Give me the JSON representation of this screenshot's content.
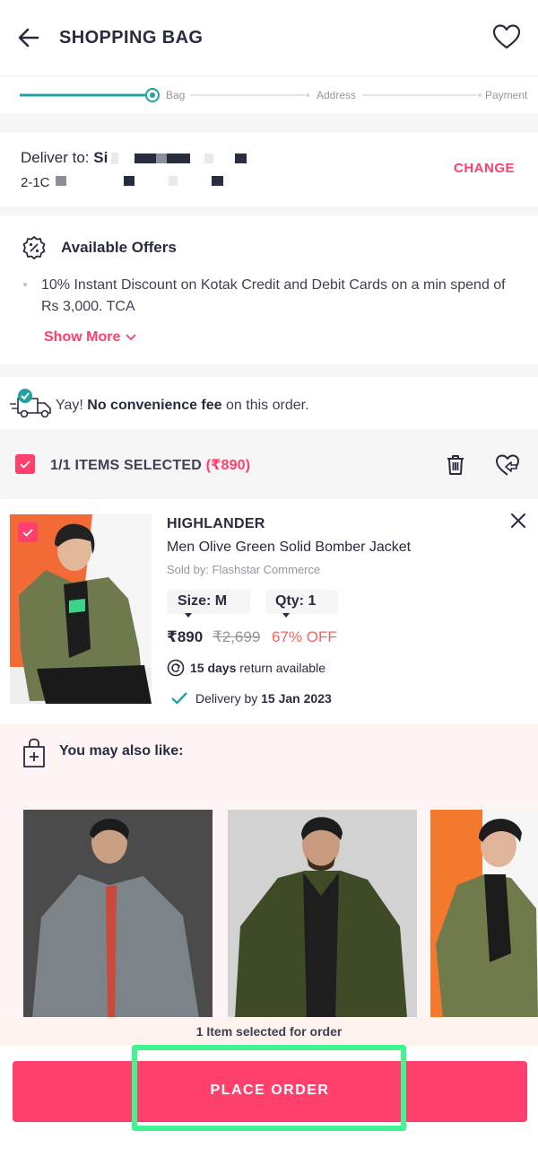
{
  "header": {
    "title": "SHOPPING BAG",
    "back_icon": "arrow-left-icon",
    "wishlist_icon": "heart-icon"
  },
  "stepper": {
    "steps": [
      "Bag",
      "Address",
      "Payment"
    ],
    "current": "Bag",
    "accent": "#20a39e"
  },
  "address": {
    "deliver_label": "Deliver to:",
    "name_visible": "Si",
    "line2_visible": "2-1C",
    "change_label": "CHANGE"
  },
  "offers": {
    "title": "Available Offers",
    "icon": "discount-badge-icon",
    "items": [
      "10% Instant Discount on Kotak Credit and Debit Cards on a min spend of Rs 3,000. TCA"
    ],
    "show_more_label": "Show More"
  },
  "fee": {
    "prefix": "Yay! ",
    "bold": "No convenience fee",
    "suffix": " on this order.",
    "icon": "delivery-truck-check-icon"
  },
  "selection": {
    "label": "1/1 ITEMS SELECTED",
    "amount": "(₹890)",
    "delete_icon": "trash-icon",
    "move_to_wishlist_icon": "heart-arrow-icon"
  },
  "product": {
    "brand": "HIGHLANDER",
    "name": "Men Olive Green Solid Bomber Jacket",
    "seller": "Sold by: Flashstar Commerce",
    "size_label": "Size: M",
    "qty_label": "Qty: 1",
    "price": "₹890",
    "mrp": "₹2,699",
    "discount": "67% OFF",
    "return_days": "15 days",
    "return_text": " return available",
    "delivery_prefix": "Delivery by ",
    "delivery_date": "15 Jan 2023",
    "remove_icon": "close-icon"
  },
  "recommendations": {
    "title": "You may also like:",
    "icon": "shopping-bag-plus-icon"
  },
  "footer": {
    "note": "1 Item selected for order",
    "place_order_label": "PLACE ORDER"
  },
  "colors": {
    "brand": "#ff3f6c",
    "text": "#282c3f",
    "highlight": "#3ef58f"
  }
}
